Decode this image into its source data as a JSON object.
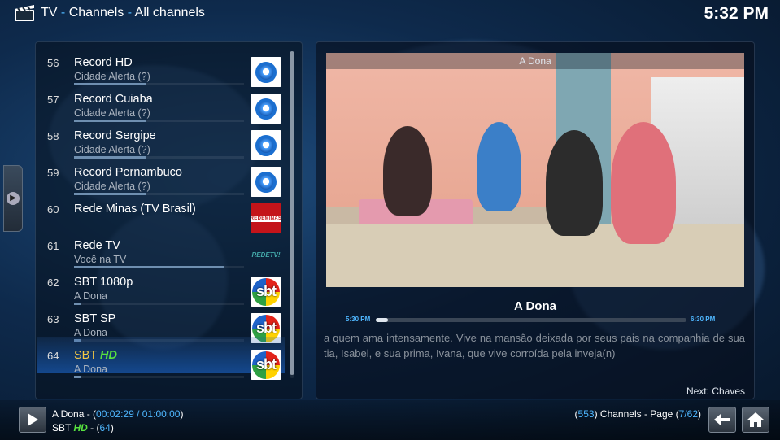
{
  "header": {
    "section": "TV",
    "crumb1": "Channels",
    "crumb2": "All channels",
    "separator": "-",
    "clock": "5:32 PM"
  },
  "channels": [
    {
      "num": "56",
      "name": "Record HD",
      "hd": "",
      "program": "Cidade Alerta (?)",
      "progress": 0.42,
      "logo": "record-logo"
    },
    {
      "num": "57",
      "name": "Record Cuiaba",
      "hd": "",
      "program": "Cidade Alerta (?)",
      "progress": 0.42,
      "logo": "record-logo"
    },
    {
      "num": "58",
      "name": "Record Sergipe",
      "hd": "",
      "program": "Cidade Alerta (?)",
      "progress": 0.42,
      "logo": "record-logo"
    },
    {
      "num": "59",
      "name": "Record Pernambuco",
      "hd": "",
      "program": "Cidade Alerta (?)",
      "progress": 0.42,
      "logo": "record-logo"
    },
    {
      "num": "60",
      "name": "Rede Minas (TV Brasil)",
      "hd": "",
      "program": "",
      "progress": 0,
      "logo": "rede-minas-logo",
      "logo_text": "REDEMINAS"
    },
    {
      "num": "61",
      "name": "Rede TV",
      "hd": "",
      "program": "Você na TV",
      "progress": 0.88,
      "logo": "redetv-logo",
      "logo_text": "REDETV!"
    },
    {
      "num": "62",
      "name": "SBT 1080p",
      "hd": "",
      "program": "A Dona",
      "progress": 0.04,
      "logo": "sbt-logo",
      "logo_text": "sbt"
    },
    {
      "num": "63",
      "name": "SBT SP",
      "hd": "",
      "program": "A Dona",
      "progress": 0.04,
      "logo": "sbt-logo",
      "logo_text": "sbt"
    },
    {
      "num": "64",
      "name": "SBT ",
      "hd": "HD",
      "program": "A Dona",
      "progress": 0.04,
      "logo": "sbt-logo",
      "logo_text": "sbt",
      "selected": true
    }
  ],
  "list_scroll": 0.99,
  "info": {
    "video_title": "A Dona",
    "program_title": "A Dona",
    "start_time": "5:30 PM",
    "end_time": "6:30 PM",
    "progress": 0.04,
    "plot": "a quem ama intensamente. Vive na mansão deixada por seus pais na companhia de sua tia, Isabel, e sua prima, Ivana, que vive corroída pela inveja(n)",
    "next": "Next: Chaves"
  },
  "footer": {
    "now_title": "A Dona",
    "dash": " - ",
    "open_paren": "(",
    "elapsed": "00:02:29 / 01:00:00",
    "close_paren": ")",
    "channel_name": "SBT ",
    "channel_hd": "HD",
    "channel_num": "64",
    "channel_count": "553",
    "channels_word": ") Channels - Page (",
    "page": "7/62",
    "close": ")"
  },
  "colors": {
    "accent": "#4fb7ff",
    "selected_text": "#f5c945",
    "hd_tag": "#58e23f"
  }
}
